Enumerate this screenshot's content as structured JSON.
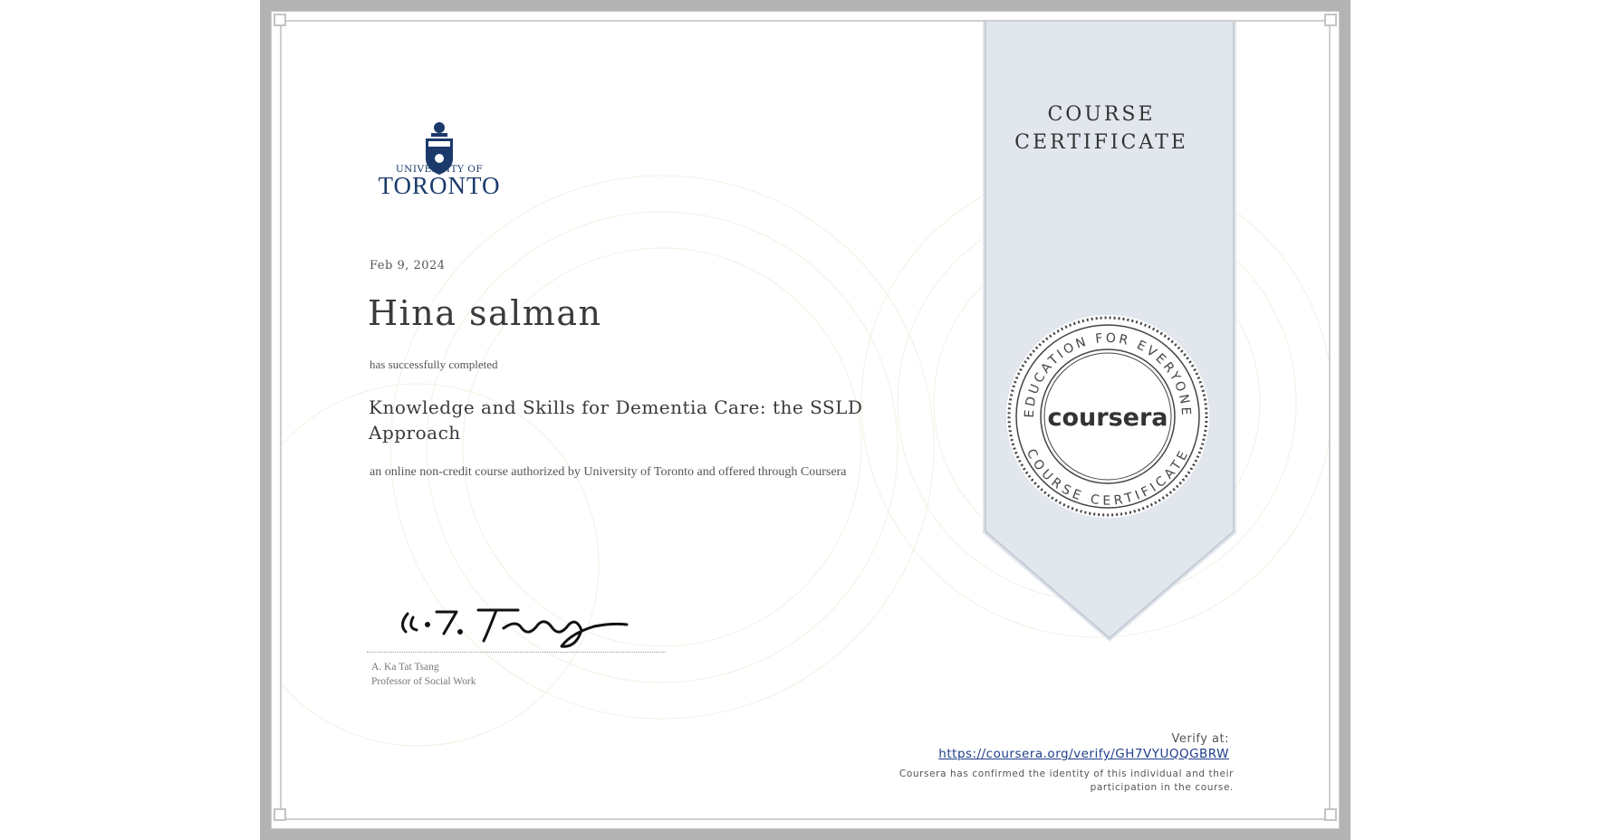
{
  "university": {
    "line1": "UNIVERSITY OF",
    "line2": "TORONTO"
  },
  "certificate": {
    "date": "Feb 9, 2024",
    "recipient": "Hina salman",
    "completed_text": "has successfully completed",
    "course_title": "Knowledge and Skills for Dementia Care: the SSLD Approach",
    "authorized_text": "an online non-credit course authorized by University of Toronto and offered through Coursera"
  },
  "signer": {
    "name": "A. Ka Tat Tsang",
    "title": "Professor of Social Work"
  },
  "ribbon": {
    "line1": "COURSE",
    "line2": "CERTIFICATE"
  },
  "seal": {
    "brand": "coursera",
    "top_text": "EDUCATION FOR EVERYONE",
    "bottom_text": "COURSE CERTIFICATE"
  },
  "verify": {
    "label": "Verify at:",
    "url": "https://coursera.org/verify/GH7VYUQQGBRW",
    "confirmation": "Coursera has confirmed the identity of this individual and their participation in the course."
  },
  "colors": {
    "frame": "#b3b3b3",
    "ribbon": "#e2e7ee",
    "university_blue": "#1b3a6b",
    "link": "#1f3d8a"
  }
}
